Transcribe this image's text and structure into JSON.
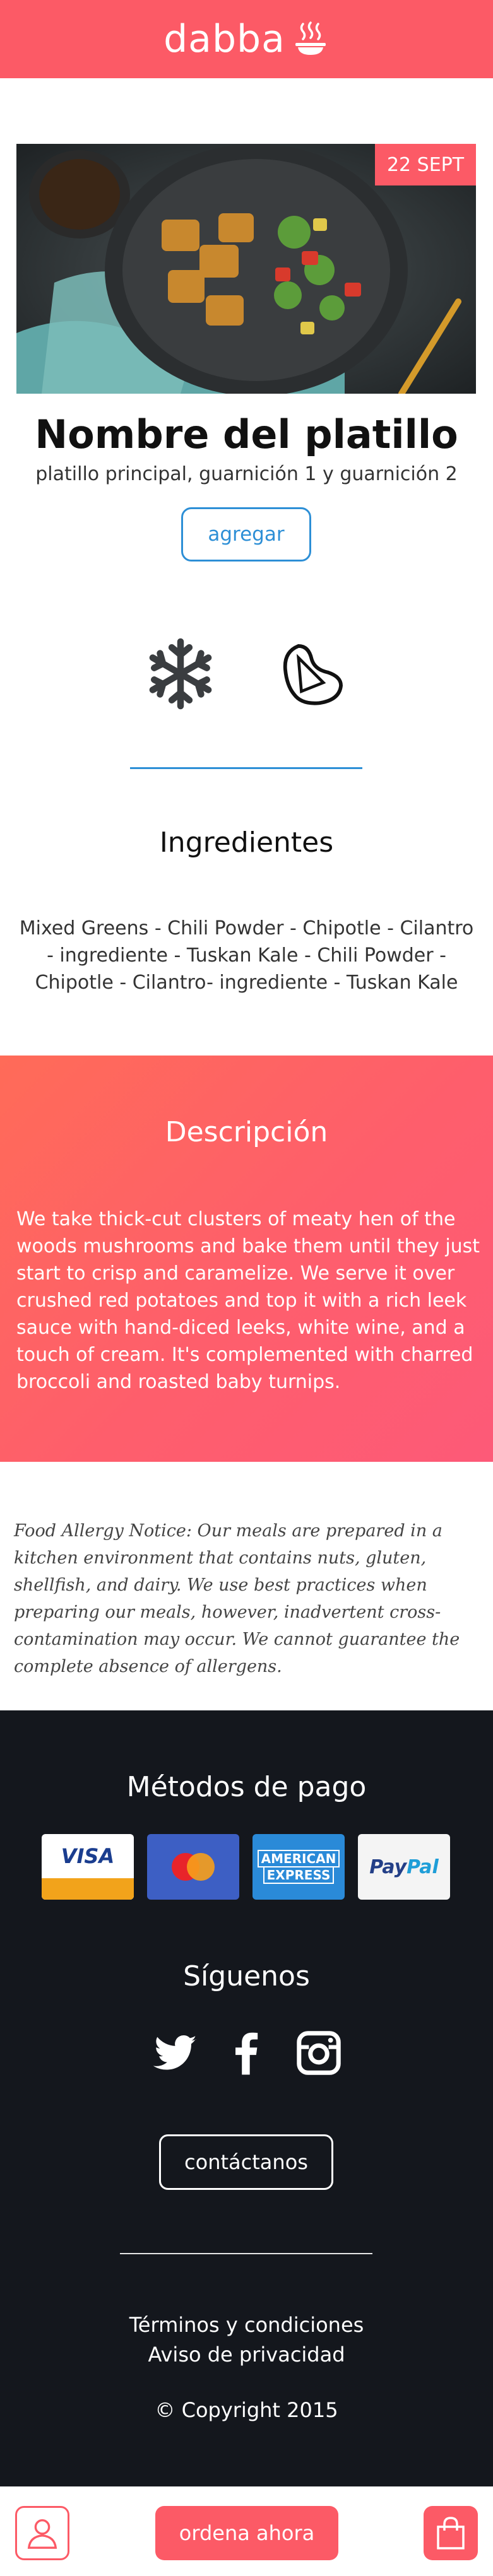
{
  "header": {
    "logo_text": "dabba",
    "logo_icon": "steaming-bowl-icon",
    "color": "#fc5a66"
  },
  "dish": {
    "date_badge": "22 SEPT",
    "title": "Nombre del platillo",
    "subtitle": "platillo principal, guarnición 1 y guarnición 2",
    "add_label": "agregar",
    "feature_icons": [
      "snowflake-icon",
      "steak-icon"
    ]
  },
  "ingredients": {
    "title": "Ingredientes",
    "text": "Mixed Greens - Chili Powder - Chipotle - Cilantro - ingrediente - Tuskan Kale - Chili Powder - Chipotle - Cilantro- ingrediente - Tuskan Kale"
  },
  "description": {
    "title": "Descripción",
    "text": "We take thick-cut clusters of meaty hen of the woods mushrooms and bake them until they just start to crisp and caramelize. We serve it over crushed red potatoes and top it with a rich leek sauce with hand-diced leeks, white wine, and a touch of cream. It's complemented with charred broccoli and roasted baby turnips."
  },
  "allergy_notice": "Food Allergy Notice: Our meals are prepared in a kitchen environment that contains nuts, gluten, shellfish, and dairy. We use best practices when preparing our meals, however, inadvertent cross-contamination may occur. We cannot guarantee the complete absence of allergens.",
  "footer": {
    "payment_title": "Métodos de pago",
    "cards": {
      "visa": "VISA",
      "amex_top": "AMERICAN",
      "amex_bottom": "EXPRESS",
      "paypal_a": "Pay",
      "paypal_b": "Pal"
    },
    "follow_title": "Síguenos",
    "social_icons": [
      "twitter-icon",
      "facebook-icon",
      "instagram-icon"
    ],
    "contact_label": "contáctanos",
    "terms_link": "Términos y condiciones",
    "privacy_link": "Aviso de privacidad",
    "copyright": "© Copyright 2015"
  },
  "bottom_bar": {
    "order_label": "ordena ahora",
    "user_icon": "user-icon",
    "cart_icon": "shopping-bag-icon"
  }
}
